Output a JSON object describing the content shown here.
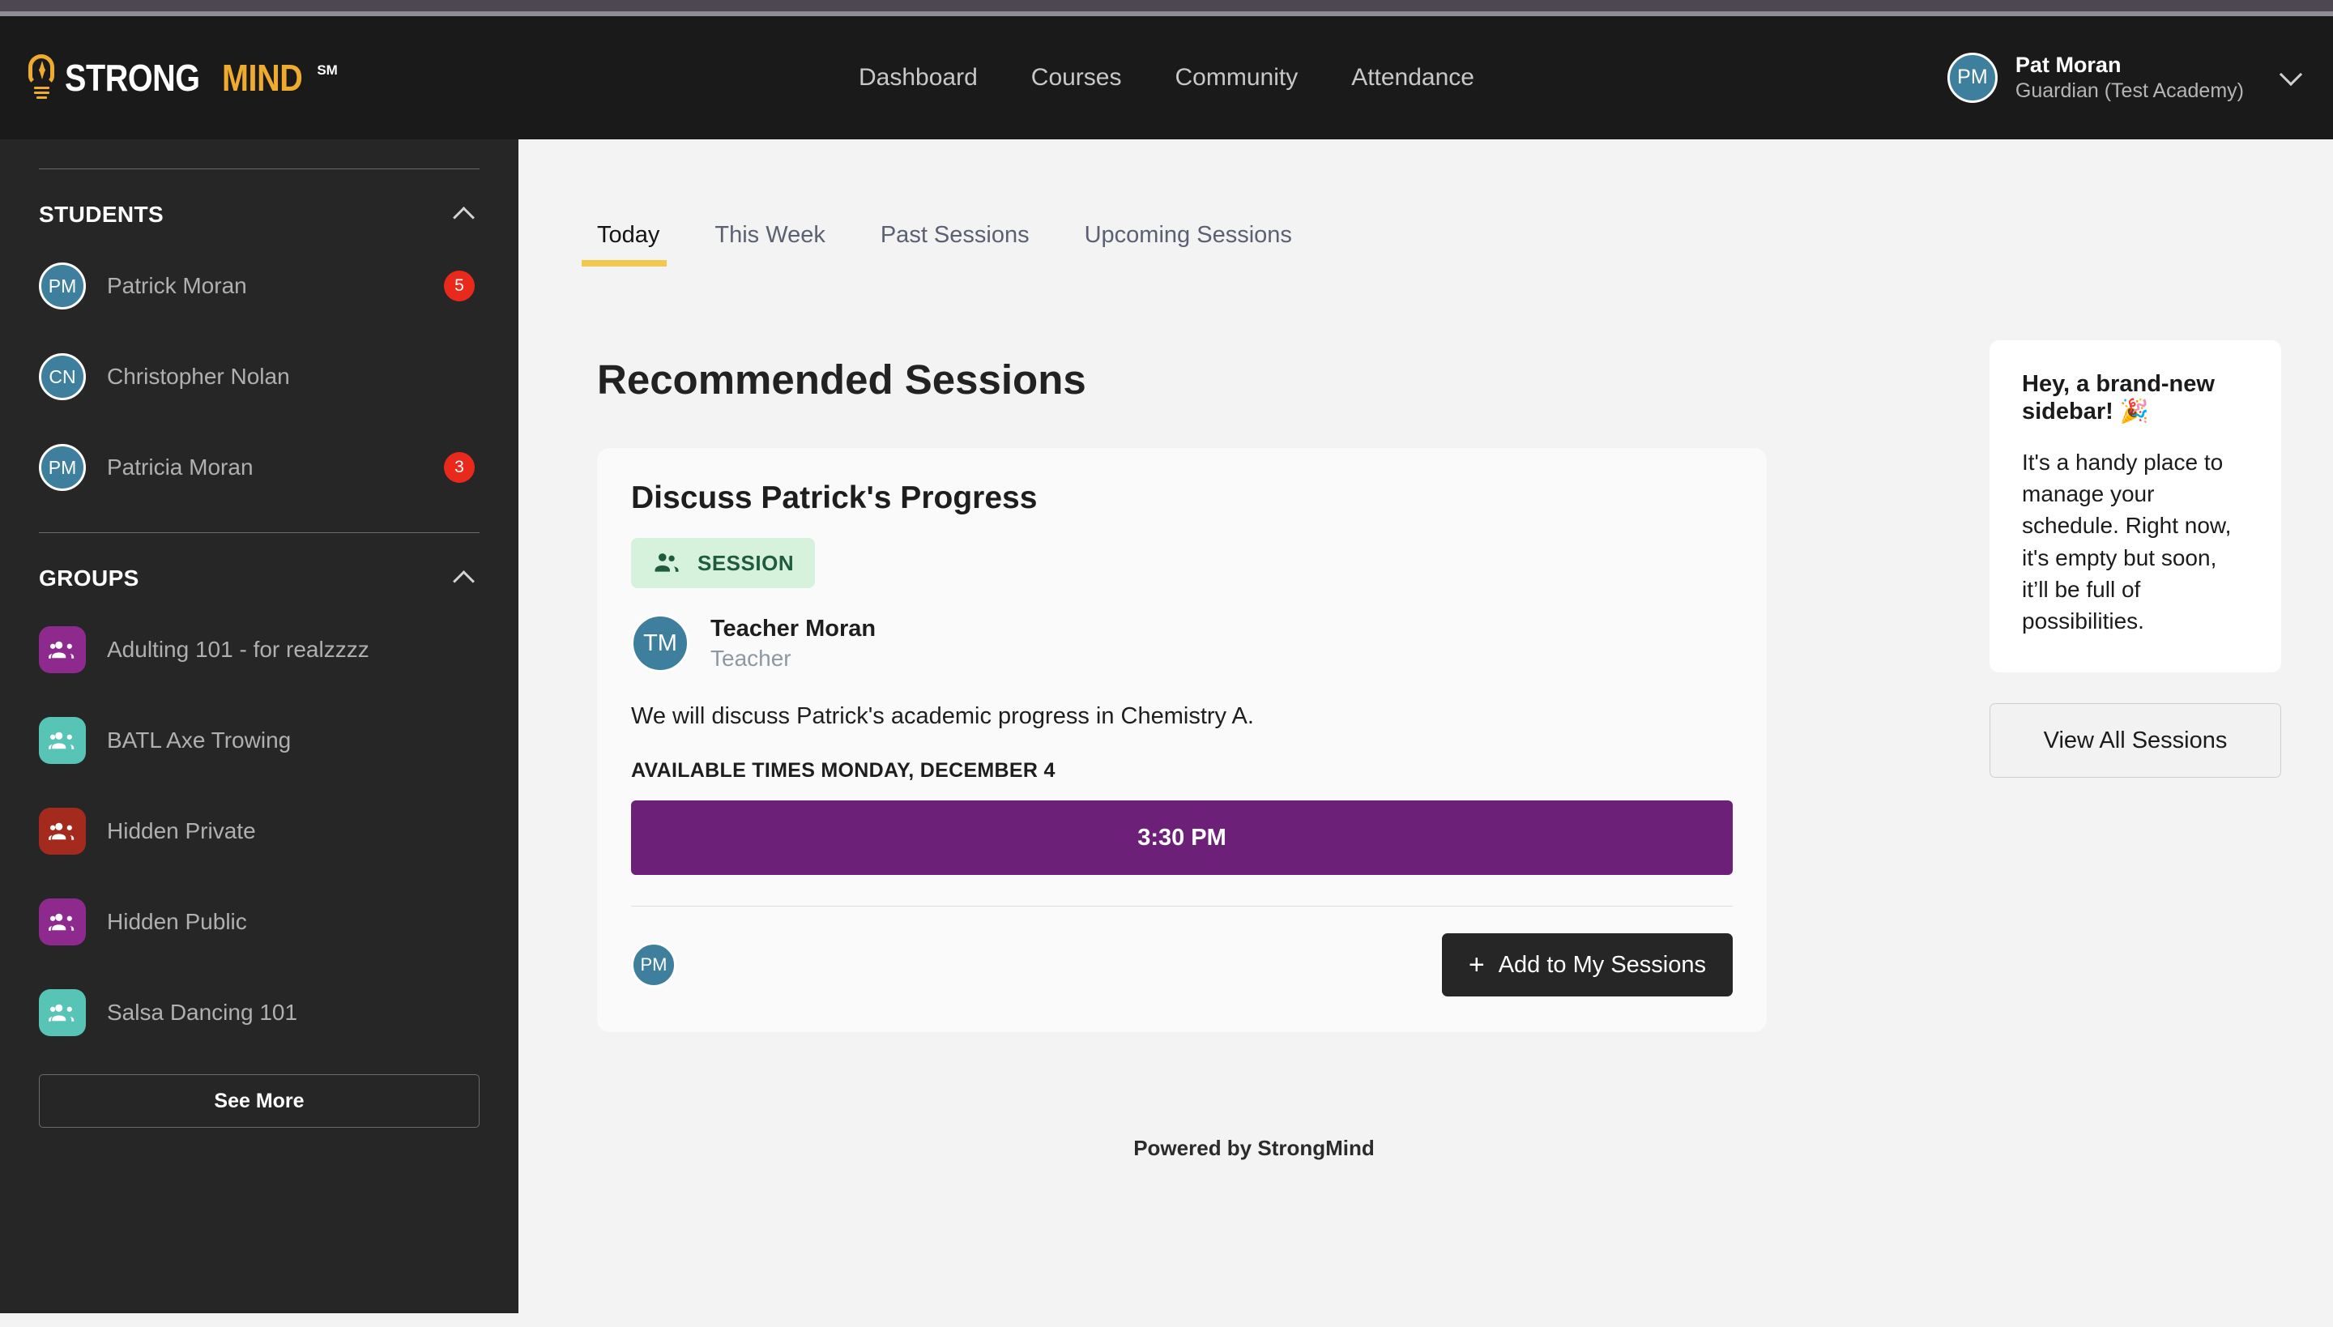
{
  "header": {
    "brand": {
      "strong": "STRONG",
      "mind": "MIND",
      "sm": "SM",
      "icon": "lightbulb-icon"
    },
    "nav": [
      {
        "label": "Dashboard"
      },
      {
        "label": "Courses"
      },
      {
        "label": "Community"
      },
      {
        "label": "Attendance"
      }
    ],
    "user": {
      "initials": "PM",
      "name": "Pat Moran",
      "role": "Guardian (Test Academy)"
    }
  },
  "sidebar": {
    "students": {
      "label": "STUDENTS",
      "items": [
        {
          "initials": "PM",
          "name": "Patrick Moran",
          "badge": "5"
        },
        {
          "initials": "CN",
          "name": "Christopher Nolan",
          "badge": ""
        },
        {
          "initials": "PM",
          "name": "Patricia Moran",
          "badge": "3"
        }
      ]
    },
    "groups": {
      "label": "GROUPS",
      "items": [
        {
          "name": "Adulting 101 - for realzzzz",
          "color": "#8e2a8e"
        },
        {
          "name": "BATL Axe Trowing",
          "color": "#57c4b5"
        },
        {
          "name": "Hidden Private",
          "color": "#a52a1e"
        },
        {
          "name": "Hidden Public",
          "color": "#8e2a8e"
        },
        {
          "name": "Salsa Dancing 101",
          "color": "#57c4b5"
        }
      ]
    },
    "see_more_label": "See More"
  },
  "main": {
    "tabs": [
      {
        "label": "Today",
        "active": true
      },
      {
        "label": "This Week",
        "active": false
      },
      {
        "label": "Past Sessions",
        "active": false
      },
      {
        "label": "Upcoming Sessions",
        "active": false
      }
    ],
    "section_title": "Recommended Sessions",
    "session": {
      "title": "Discuss Patrick's Progress",
      "badge_label": "SESSION",
      "badge_bg": "#d6f2dd",
      "badge_fg": "#1f5b3f",
      "host": {
        "initials": "TM",
        "name": "Teacher Moran",
        "role": "Teacher"
      },
      "description": "We will discuss Patrick's academic progress in Chemistry A.",
      "available_times_label": "AVAILABLE TIMES MONDAY, DECEMBER 4",
      "time_slot": "3:30 PM",
      "time_slot_color": "#6d2077",
      "attendee_initials": "PM",
      "add_button_label": "Add to My Sessions",
      "add_button_plus": "+"
    },
    "footer_note": "Powered by StrongMind"
  },
  "right_rail": {
    "promo_title": "Hey, a brand-new sidebar! 🎉",
    "promo_body": "It's a handy place to manage your schedule. Right now, it's empty but soon, it’ll be full of possibilities.",
    "view_all_label": "View All Sessions"
  }
}
